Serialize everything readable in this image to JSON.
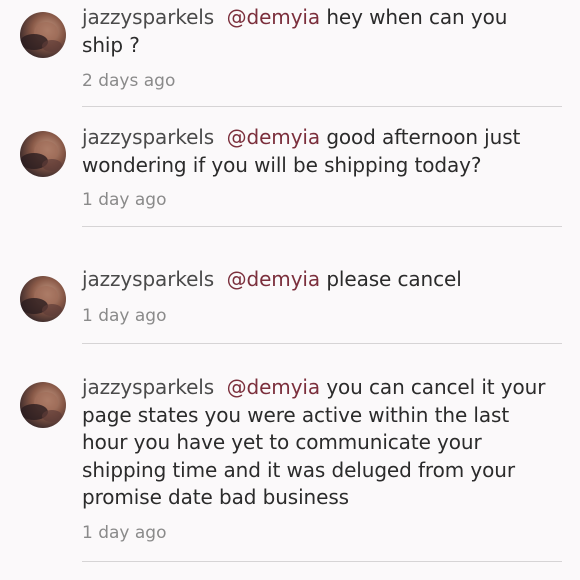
{
  "comments": [
    {
      "username": "jazzysparkels",
      "mention": "@demyia",
      "message": "hey when can you ship ?",
      "time": "2 days ago"
    },
    {
      "username": "jazzysparkels",
      "mention": "@demyia",
      "message": "good afternoon just wondering if you will be shipping today?",
      "time": "1 day ago"
    },
    {
      "username": "jazzysparkels",
      "mention": "@demyia",
      "message": "please cancel",
      "time": "1 day ago"
    },
    {
      "username": "jazzysparkels",
      "mention": "@demyia",
      "message": " you can cancel it your page states you were active within the last hour you have yet to communicate your shipping time and it was deluged from your promise date bad business",
      "time": "1 day ago"
    }
  ],
  "colors": {
    "background": "#fbf9fa",
    "mention": "#7b2f3c",
    "timestamp": "#8a8a8a",
    "divider": "#d6d4d5"
  },
  "icons": {
    "avatar": "user-avatar-photo"
  }
}
